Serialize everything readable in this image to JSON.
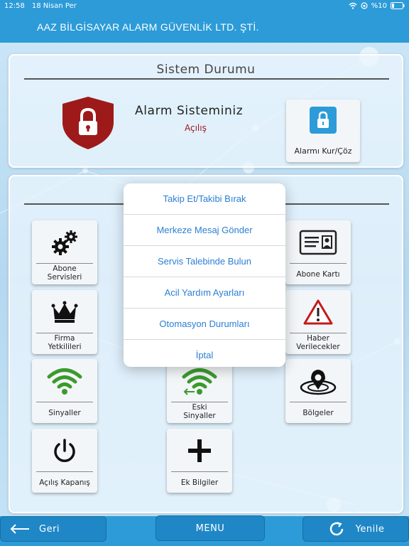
{
  "status_bar": {
    "time": "12:58",
    "date": "18 Nisan Per",
    "battery": "%10"
  },
  "header": {
    "title": "AAZ BİLGİSAYAR ALARM GÜVENLİK LTD. ŞTİ."
  },
  "system_panel": {
    "title": "Sistem Durumu",
    "alarm_title": "Alarm Sisteminiz",
    "alarm_status": "Açılış",
    "arm_button": "Alarmı Kur/Çöz"
  },
  "tiles": {
    "abone_servisleri": "Abone\nServisleri",
    "abone_karti": "Abone Kartı",
    "firma_yetkilileri": "Firma\nYetkilileri",
    "haber_verilecekler": "Haber\nVerilecekler",
    "sinyaller": "Sinyaller",
    "eski_sinyaller": "Eski\nSinyaller",
    "bolgeler": "Bölgeler",
    "acilis_kapanis": "Açılış Kapanış",
    "ek_bilgiler": "Ek Bilgiler"
  },
  "popup": {
    "items": [
      "Takip Et/Takibi Bırak",
      "Merkeze Mesaj Gönder",
      "Servis Talebinde Bulun",
      "Acil Yardım Ayarları",
      "Otomasyon Durumları",
      "İptal"
    ]
  },
  "bottom": {
    "back": "Geri",
    "menu": "MENU",
    "refresh": "Yenile"
  },
  "colors": {
    "header": "#2c9bd8",
    "danger": "#a01818",
    "link": "#2a7fd4",
    "signal": "#3c9a2e"
  }
}
